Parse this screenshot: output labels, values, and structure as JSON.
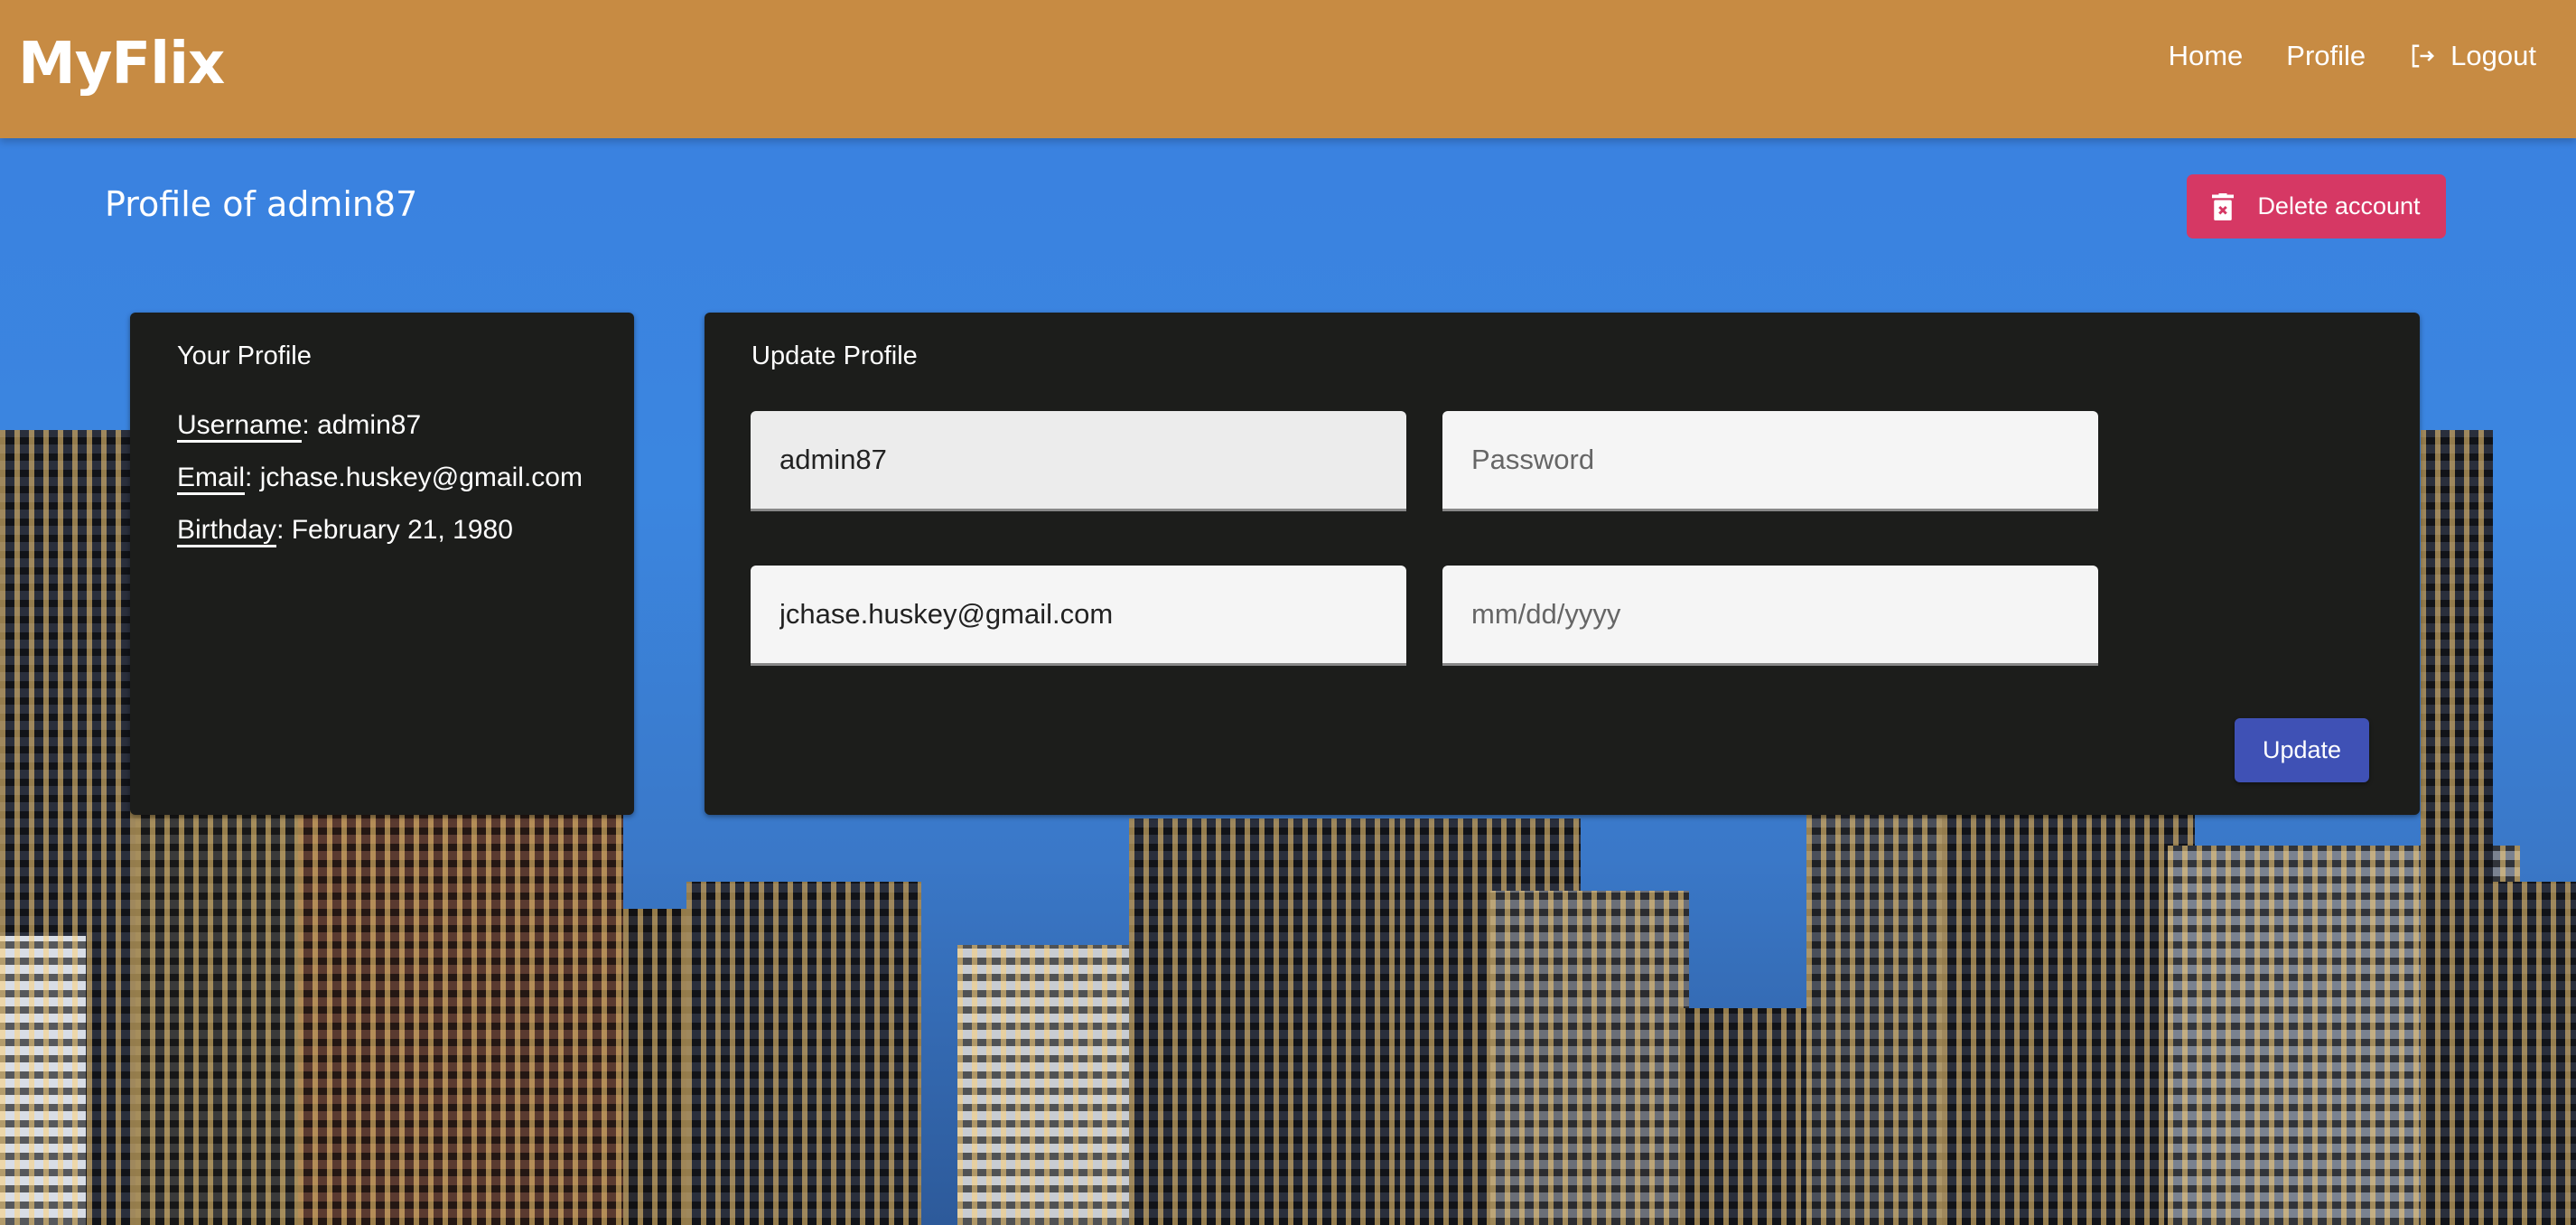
{
  "header": {
    "logo": "MyFlix",
    "nav": {
      "home": "Home",
      "profile": "Profile",
      "logout": "Logout"
    }
  },
  "page": {
    "title": "Profile of admin87",
    "delete_label": "Delete account"
  },
  "your_profile": {
    "title": "Your Profile",
    "username_label": "Username",
    "username": "admin87",
    "email_label": "Email",
    "email": "jchase.huskey@gmail.com",
    "birthday_label": "Birthday",
    "birthday": "February 21, 1980"
  },
  "update_profile": {
    "title": "Update Profile",
    "username_value": "admin87",
    "password_placeholder": "Password",
    "email_value": "jchase.huskey@gmail.com",
    "birthday_placeholder": "mm/dd/yyyy",
    "update_label": "Update"
  },
  "colors": {
    "header": "#c78b43",
    "delete": "#d63864",
    "update": "#3f51b5",
    "card": "#1c1d1b"
  },
  "icons": {
    "logout": "logout-icon",
    "delete": "trash-icon"
  }
}
